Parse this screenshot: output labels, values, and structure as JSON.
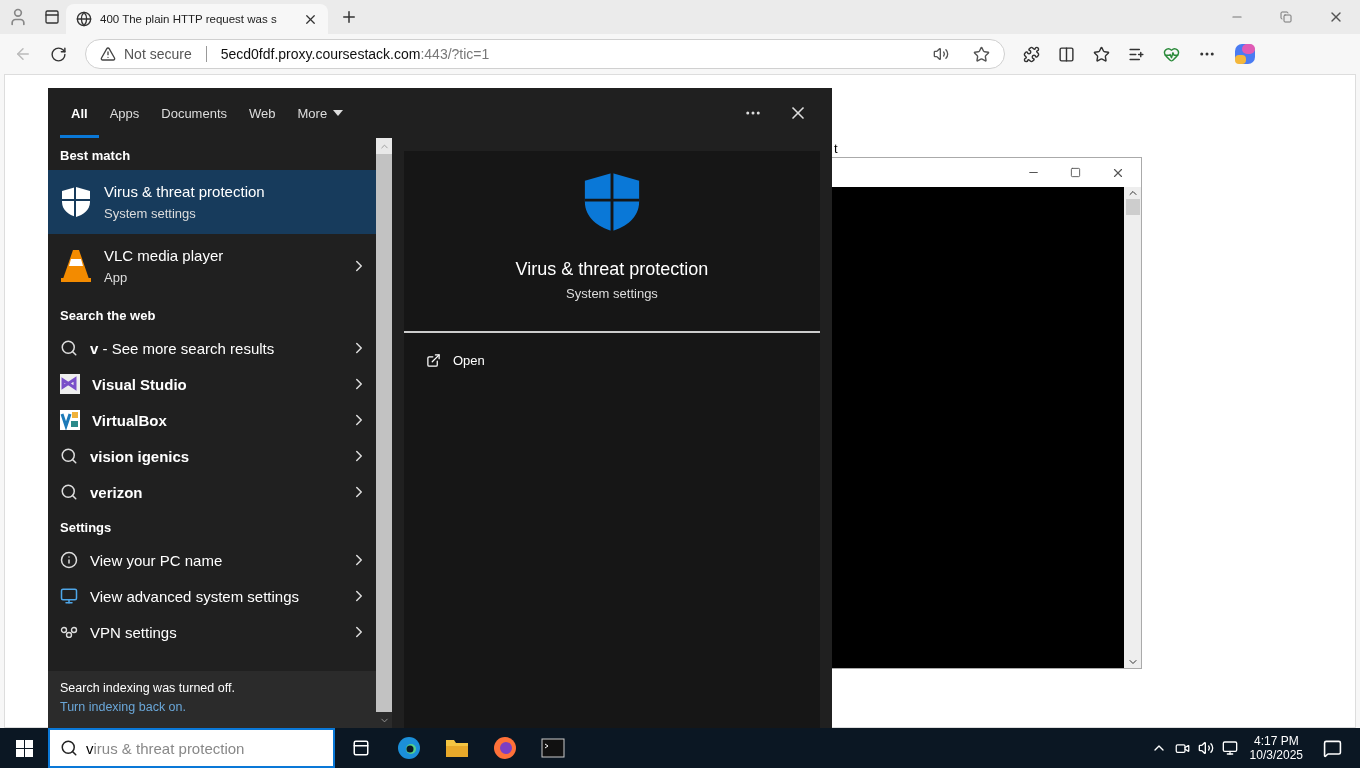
{
  "browser": {
    "tab": {
      "title": "400 The plain HTTP request was s"
    },
    "address": {
      "security": "Not secure",
      "host": "5ecd0fdf.proxy.coursestack.com",
      "path": ":443/?tic=1"
    }
  },
  "page": {
    "text_fragment": "t"
  },
  "search": {
    "tabs": [
      {
        "label": "All",
        "selected": true
      },
      {
        "label": "Apps",
        "selected": false
      },
      {
        "label": "Documents",
        "selected": false
      },
      {
        "label": "Web",
        "selected": false
      },
      {
        "label": "More",
        "selected": false
      }
    ],
    "sections": [
      {
        "heading": "Best match",
        "items": [
          {
            "kind": "shield",
            "title": "Virus & threat protection",
            "subtitle": "System settings",
            "selected": true,
            "bold": false,
            "has_arrow": false
          },
          {
            "kind": "vlc",
            "title": "VLC media player",
            "subtitle": "App",
            "selected": false,
            "bold": false,
            "has_arrow": true
          }
        ]
      },
      {
        "heading": "Search the web",
        "items": [
          {
            "kind": "search",
            "title": "**v** - See more search results",
            "selected": false,
            "bold": false,
            "has_arrow": true
          },
          {
            "kind": "studio",
            "title": "Visual Studio",
            "selected": false,
            "bold": true,
            "has_arrow": true
          },
          {
            "kind": "vbox",
            "title": "VirtualBox",
            "selected": false,
            "bold": true,
            "has_arrow": true
          },
          {
            "kind": "search",
            "title": "vision igenics",
            "selected": false,
            "bold": true,
            "has_arrow": true
          },
          {
            "kind": "search",
            "title": "verizon",
            "selected": false,
            "bold": true,
            "has_arrow": true
          }
        ]
      },
      {
        "heading": "Settings",
        "items": [
          {
            "kind": "info",
            "title": "View your PC name",
            "selected": false,
            "bold": false,
            "has_arrow": true
          },
          {
            "kind": "monitor",
            "title": "View advanced system settings",
            "selected": false,
            "bold": false,
            "has_arrow": true
          },
          {
            "kind": "vpn",
            "title": "VPN settings",
            "selected": false,
            "bold": false,
            "has_arrow": true
          }
        ]
      }
    ],
    "footer": {
      "message": "Search indexing was turned off.",
      "link": "Turn indexing back on."
    },
    "preview": {
      "title": "Virus & threat protection",
      "subtitle": "System settings",
      "actions": [
        {
          "label": "Open"
        }
      ]
    }
  },
  "taskbar": {
    "search": {
      "value": "v",
      "suggestion": "irus & threat protection"
    },
    "time": "4:17 PM",
    "date": "10/3/2025"
  }
}
